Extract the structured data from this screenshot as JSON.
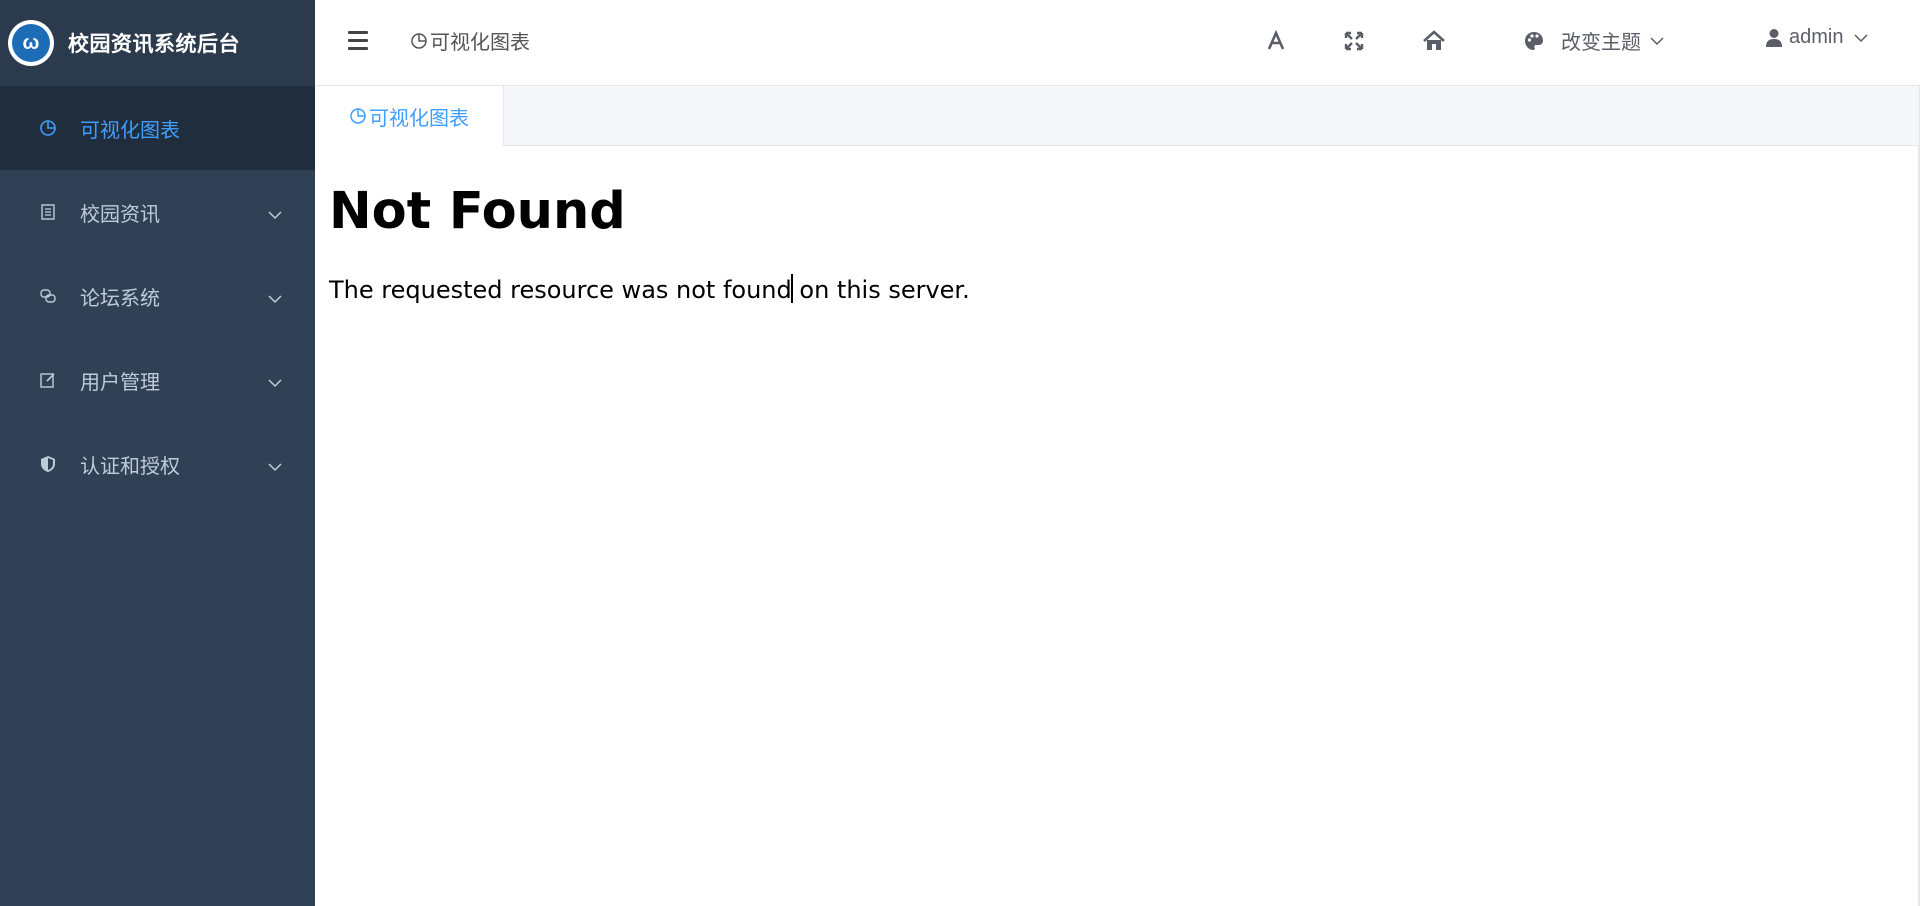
{
  "app": {
    "title": "校园资讯系统后台",
    "logo_text": "ω"
  },
  "sidebar": {
    "items": [
      {
        "label": "可视化图表",
        "icon": "pie-chart-icon",
        "active": true
      },
      {
        "label": "校园资讯",
        "icon": "news-icon",
        "expandable": true
      },
      {
        "label": "论坛系统",
        "icon": "forum-icon",
        "expandable": true
      },
      {
        "label": "用户管理",
        "icon": "edit-icon",
        "expandable": true
      },
      {
        "label": "认证和授权",
        "icon": "shield-icon",
        "expandable": true
      }
    ]
  },
  "header": {
    "breadcrumb": "可视化图表",
    "theme_label": "改变主题",
    "user_label": "admin",
    "icons": [
      "font-size-icon",
      "fullscreen-icon",
      "home-icon",
      "palette-icon",
      "user-icon"
    ]
  },
  "tabs": [
    {
      "label": "可视化图表",
      "active": true
    }
  ],
  "content": {
    "title": "Not Found",
    "message": "The requested resource was not found on this server."
  },
  "colors": {
    "sidebar_bg": "#304156",
    "sidebar_active_bg": "#1f2d3d",
    "accent": "#409eff",
    "sidebar_text": "#bfcbd9"
  }
}
